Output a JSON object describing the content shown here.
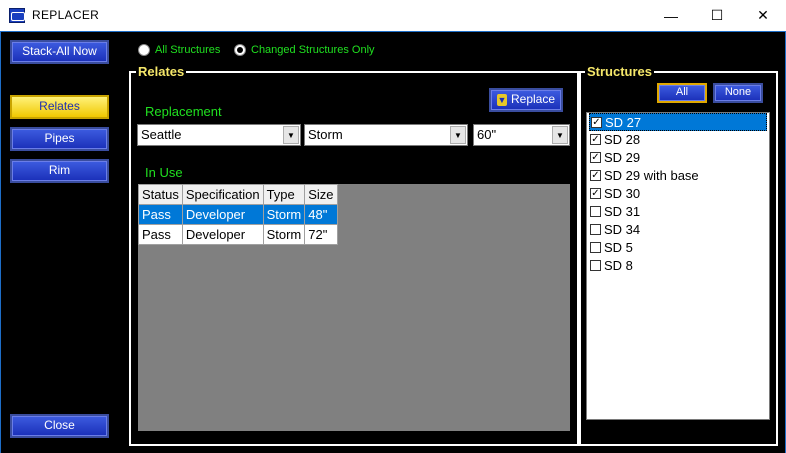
{
  "window": {
    "title": "REPLACER",
    "minimize": "—",
    "maximize": "☐",
    "close": "✕"
  },
  "left": {
    "stack_all": "Stack-All Now",
    "relates": "Relates",
    "pipes": "Pipes",
    "rim": "Rim",
    "close": "Close"
  },
  "filter": {
    "all_structures": "All Structures",
    "changed_only": "Changed Structures Only",
    "selected": "changed_only"
  },
  "relates": {
    "title": "Relates",
    "replacement_label": "Replacement",
    "replace_button": "Replace",
    "combo1": "Seattle",
    "combo2": "Storm",
    "combo3": "60\"",
    "in_use_label": "In Use",
    "columns": [
      "Status",
      "Specification",
      "Type",
      "Size"
    ],
    "rows": [
      {
        "status": "Pass",
        "spec": "Developer",
        "type": "Storm",
        "size": "48\"",
        "selected": true
      },
      {
        "status": "Pass",
        "spec": "Developer",
        "type": "Storm",
        "size": "72\"",
        "selected": false
      }
    ]
  },
  "structures": {
    "title": "Structures",
    "all": "All",
    "none": "None",
    "items": [
      {
        "label": "SD 27",
        "checked": true,
        "selected": true
      },
      {
        "label": "SD 28",
        "checked": true,
        "selected": false
      },
      {
        "label": "SD 29",
        "checked": true,
        "selected": false
      },
      {
        "label": "SD 29 with base",
        "checked": true,
        "selected": false
      },
      {
        "label": "SD 30",
        "checked": true,
        "selected": false
      },
      {
        "label": "SD 31",
        "checked": false,
        "selected": false
      },
      {
        "label": "SD 34",
        "checked": false,
        "selected": false
      },
      {
        "label": "SD 5",
        "checked": false,
        "selected": false
      },
      {
        "label": "SD 8",
        "checked": false,
        "selected": false
      }
    ]
  },
  "colors": {
    "accent_green": "#20e020",
    "title_yellow": "#f5e76a",
    "selection_blue": "#0078d7"
  }
}
